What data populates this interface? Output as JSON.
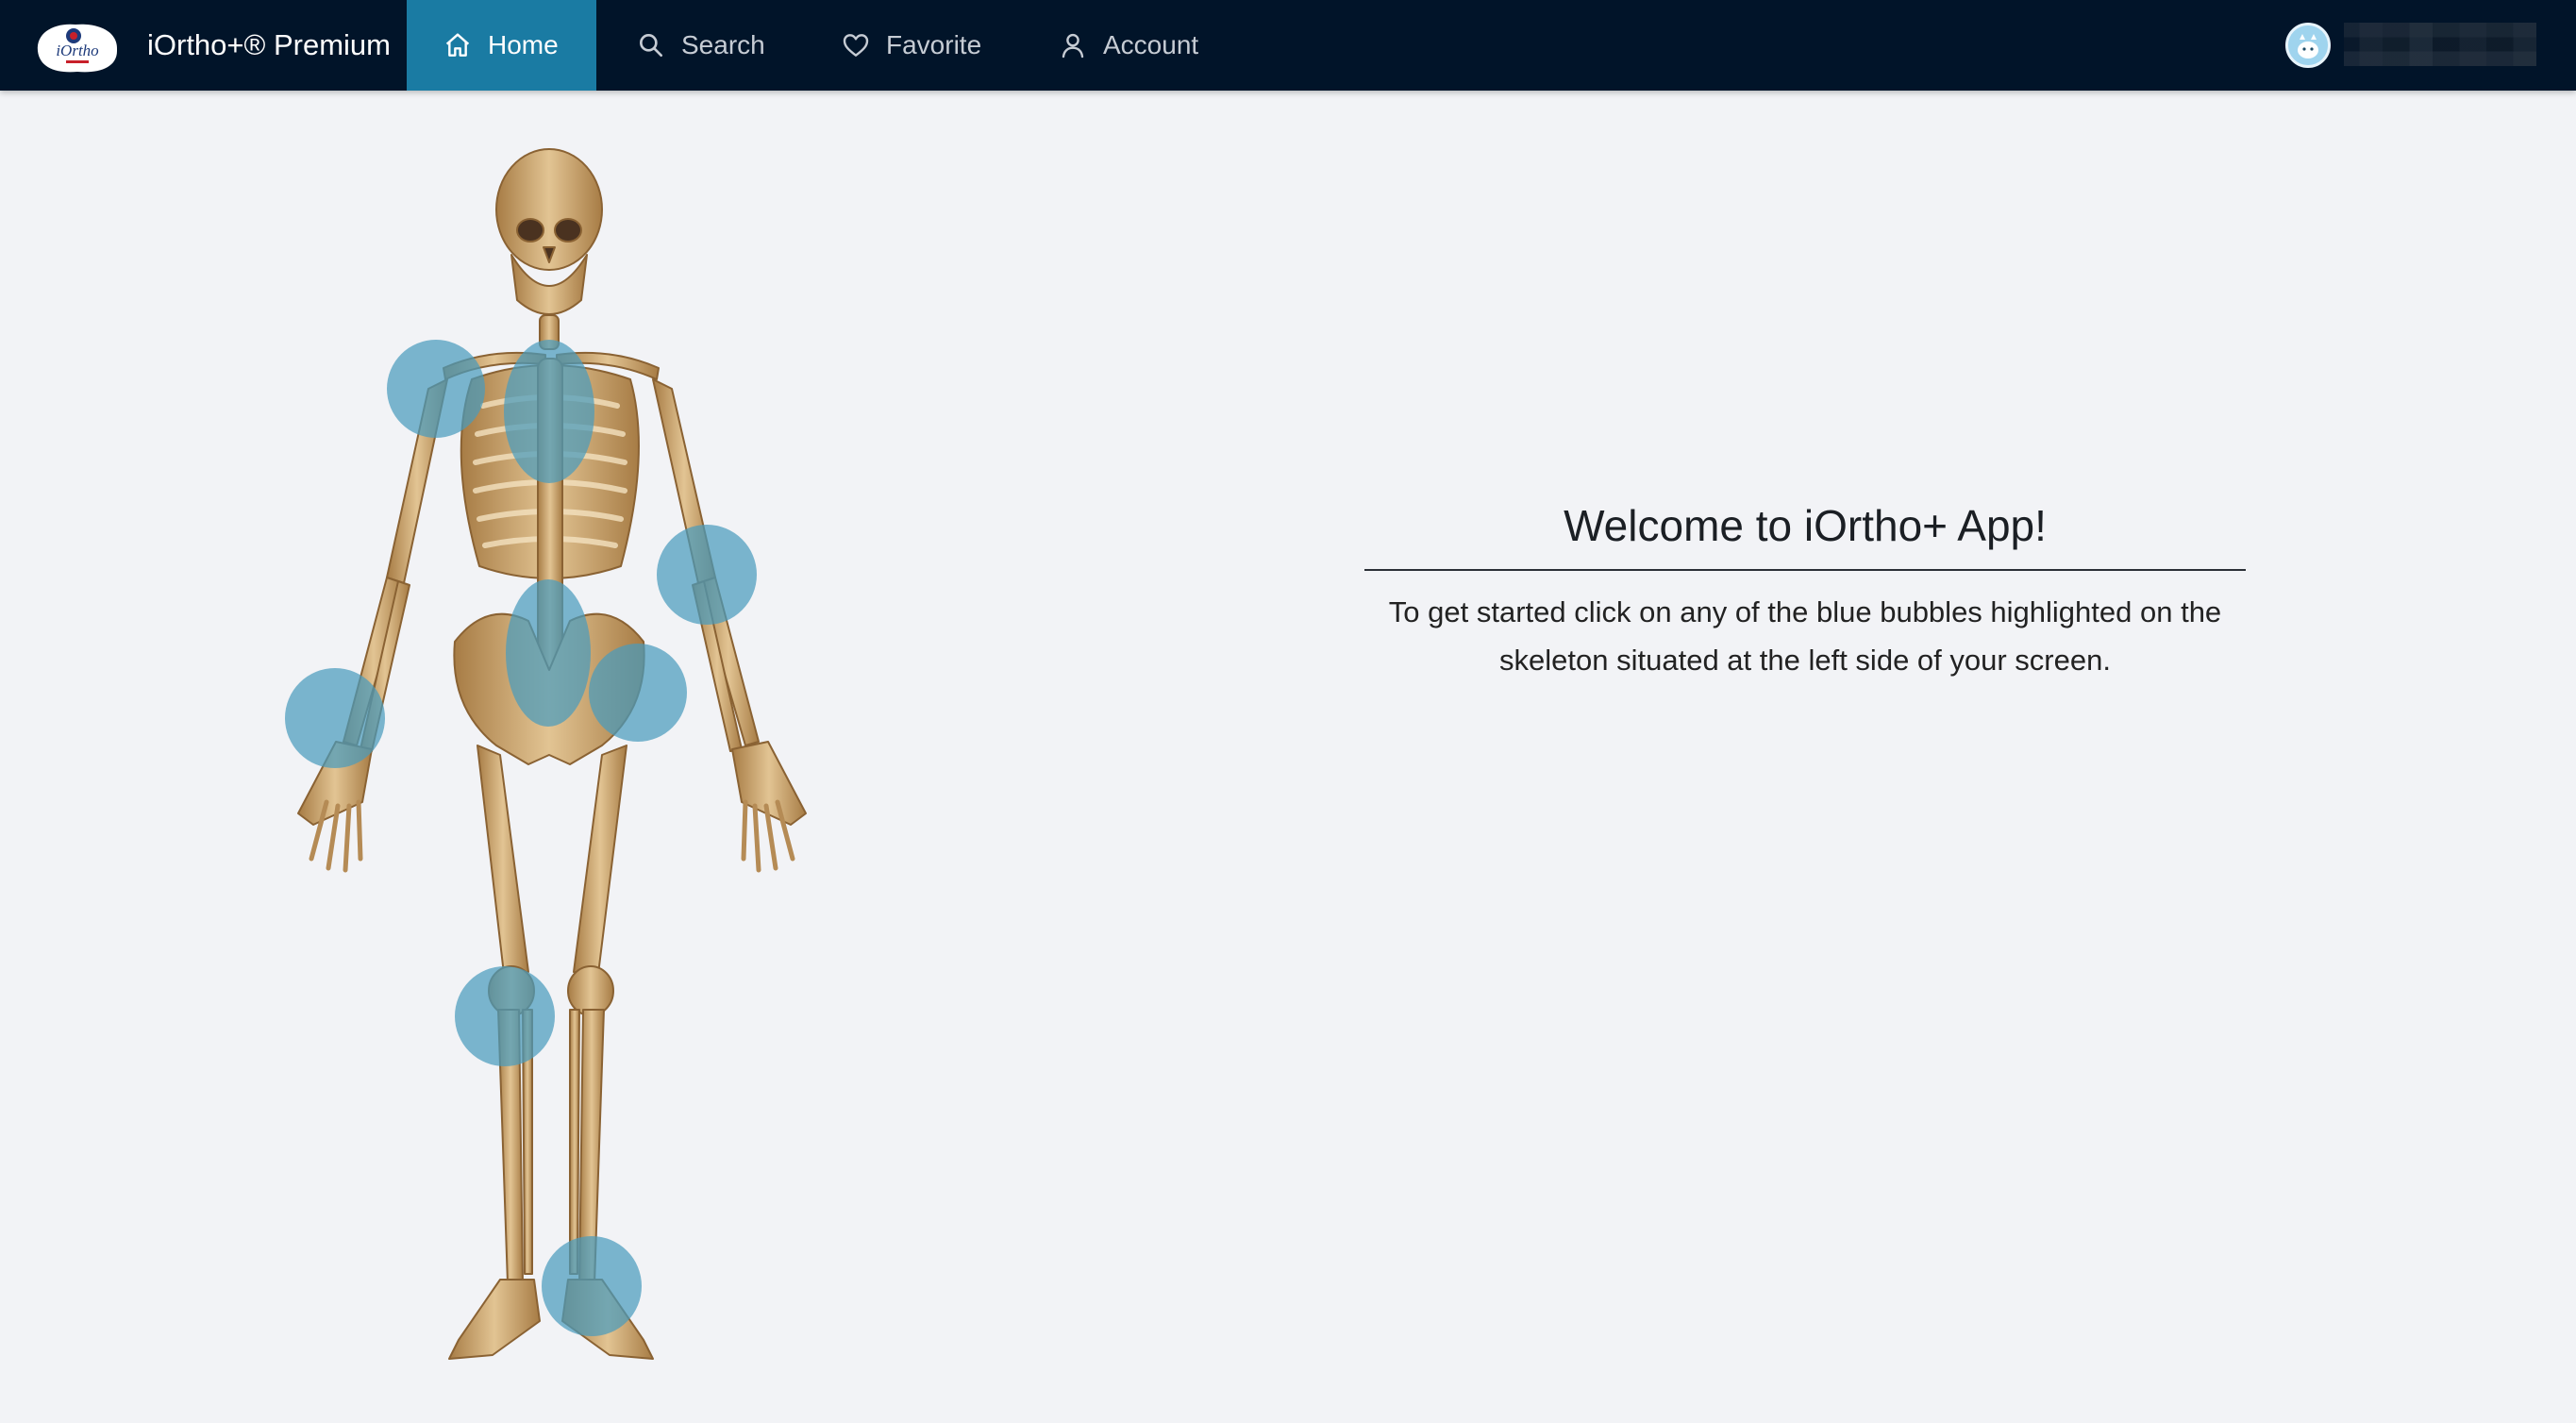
{
  "app": {
    "logo_text": "iOrtho",
    "title": "iOrtho+® Premium"
  },
  "nav": {
    "items": [
      {
        "label": "Home",
        "icon": "home-icon",
        "active": true
      },
      {
        "label": "Search",
        "icon": "search-icon",
        "active": false
      },
      {
        "label": "Favorite",
        "icon": "heart-icon",
        "active": false
      },
      {
        "label": "Account",
        "icon": "user-icon",
        "active": false
      }
    ]
  },
  "skeleton": {
    "regions": [
      "shoulder",
      "spine",
      "elbow",
      "hand-wrist",
      "lumbar-pelvis",
      "hip",
      "knee",
      "foot-ankle"
    ]
  },
  "welcome": {
    "title": "Welcome to iOrtho+ App!",
    "text": "To get started click on any of the blue bubbles highlighted on the skeleton situated at the left side of your screen."
  },
  "colors": {
    "navbar": "#011429",
    "nav_active": "#1a7ba3",
    "bubble": "#4a9bbc",
    "background": "#f2f3f6",
    "bone": "#d1b07c"
  }
}
